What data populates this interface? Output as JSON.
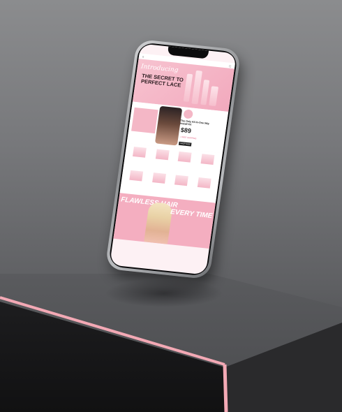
{
  "phone": {
    "hero": {
      "script_text": "Introducing",
      "headline": "THE SECRET TO PERFECT LACE",
      "subtext": "",
      "colors": {
        "background": "#f4b7c6"
      }
    },
    "promo": {
      "badge": "",
      "title": "The Only All-In-One Wig Install Kit",
      "price": "$89",
      "note": "+ FREE SHIPPING",
      "button": "SHOP NOW"
    },
    "banner": {
      "left_text": "FLAWLESS HAIR",
      "right_text": "EVERY TIME"
    }
  },
  "colors": {
    "accent_pink": "#f4aec0",
    "dark": "#222222",
    "edge_glow": "#f3a9b5"
  }
}
